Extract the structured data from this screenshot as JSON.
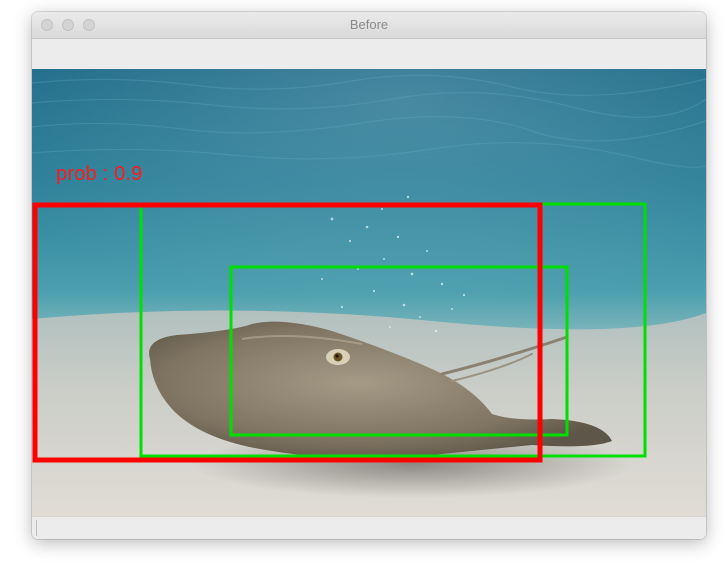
{
  "window": {
    "title": "Before"
  },
  "detections": [
    {
      "label": "prob : 0.9",
      "color": "#ff0000",
      "highlighted": true
    },
    {
      "label": "",
      "color": "#00e000",
      "highlighted": false
    },
    {
      "label": "",
      "color": "#00e000",
      "highlighted": false
    }
  ],
  "image": {
    "subject": "stingray on sandy sea floor",
    "palette": {
      "water_top": "#1f6f8c",
      "water_mid": "#3f97aa",
      "sand": "#c9c6bc",
      "ray": "#8a7e6a"
    }
  },
  "icons": {
    "close": "window-close-icon",
    "minimize": "window-minimize-icon",
    "maximize": "window-maximize-icon"
  }
}
